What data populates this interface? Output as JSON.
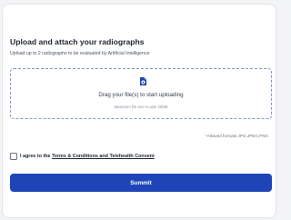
{
  "upload": {
    "title": "Upload and attach your radiographs",
    "subtitle": "Upload up to 2 radiographs to be evaluated by Artificial Intelligence",
    "dropzone": {
      "icon": "file-upload-icon",
      "prompt": "Drag your file(s) to start uploading",
      "max_size": "Maximum file size is upto 20MB"
    },
    "allowed_formats": "*Allowed formats JPG,JPEG,PNG"
  },
  "consent": {
    "checked": false,
    "prefix": "I agree to the ",
    "link_label": "Terms & Conditions and Telehealth Consent"
  },
  "actions": {
    "submit_label": "Summit"
  },
  "colors": {
    "accent": "#1f44b8",
    "dropzone_border": "#7f97c7",
    "background": "#f3f4f6"
  }
}
